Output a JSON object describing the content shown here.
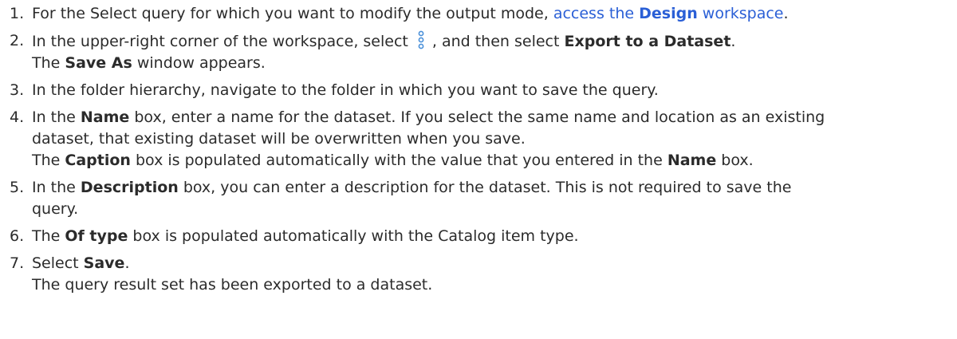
{
  "steps": [
    {
      "num": "1.",
      "pre": "For the Select query for which you want to modify the output mode, ",
      "link": {
        "t1": "access the ",
        "bold": "Design",
        "t2": " workspace"
      },
      "post": "."
    },
    {
      "num": "2.",
      "t1": "In the upper-right corner of the workspace, select",
      "icon": "kebab-menu-icon",
      "t2": ", and then select ",
      "b1": "Export to a Dataset",
      "t3": ".",
      "result_b": "Save As",
      "result_t": " window appears.",
      "result_pre": "The "
    },
    {
      "num": "3.",
      "text": "In the folder hierarchy, navigate to the folder in which you want to save the query."
    },
    {
      "num": "4.",
      "t1": "In the ",
      "b1": "Name",
      "t2": " box, enter a name for the dataset. If you select the same name and location as an existing",
      "l2": "dataset, that existing dataset will be overwritten when you save.",
      "r1": "The ",
      "rb1": "Caption",
      "r2": " box is populated automatically with the value that you entered in the ",
      "rb2": "Name",
      "r3": " box."
    },
    {
      "num": "5.",
      "t1": "In the ",
      "b1": "Description",
      "t2": " box, you can enter a description for the dataset. This is not required to save the",
      "l2": "query."
    },
    {
      "num": "6.",
      "t1": "The ",
      "b1": "Of type",
      "t2": " box is populated automatically with the Catalog item type."
    },
    {
      "num": "7.",
      "t1": "Select ",
      "b1": "Save",
      "t2": ".",
      "result": "The query result set has been exported to a dataset."
    }
  ],
  "colors": {
    "text": "#2b2b2b",
    "link": "#2a5fd6",
    "icon": "#4a90d9"
  }
}
